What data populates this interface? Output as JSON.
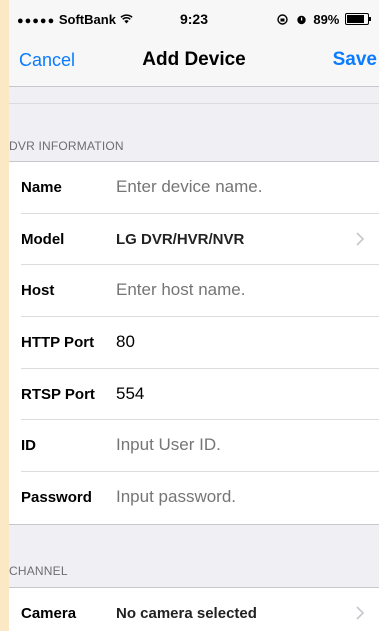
{
  "status_bar": {
    "signal_dots": "●●●●●",
    "carrier": "SoftBank",
    "wifi_icon": "wifi-icon",
    "time": "9:23",
    "battery_percent": "89%",
    "battery_level": 0.89
  },
  "nav": {
    "cancel_label": "Cancel",
    "title": "Add Device",
    "save_label": "Save"
  },
  "sections": {
    "dvr_header": "DVR INFORMATION",
    "channel_header": "CHANNEL"
  },
  "dvr_rows": {
    "name": {
      "label": "Name",
      "placeholder": "Enter device name."
    },
    "model": {
      "label": "Model",
      "value": "LG DVR/HVR/NVR"
    },
    "host": {
      "label": "Host",
      "placeholder": "Enter host name."
    },
    "http_port": {
      "label": "HTTP Port",
      "value": "80"
    },
    "rtsp_port": {
      "label": "RTSP Port",
      "value": "554"
    },
    "id": {
      "label": "ID",
      "placeholder": "Input User ID."
    },
    "password": {
      "label": "Password",
      "placeholder": "Input password."
    }
  },
  "channel_rows": {
    "camera": {
      "label": "Camera",
      "value": "No camera selected"
    }
  },
  "colors": {
    "accent": "#0a7bff",
    "placeholder": "#c7c7cd",
    "background": "#efeff4"
  }
}
